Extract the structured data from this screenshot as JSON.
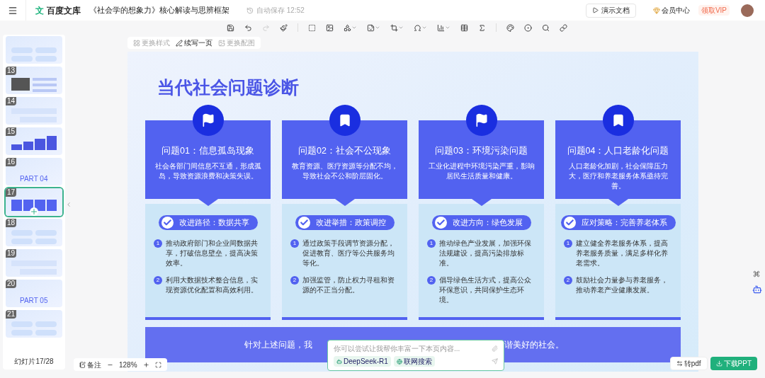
{
  "header": {
    "logo_mark": "文",
    "logo_text": "百度文库",
    "doc_title": "《社会学的想象力》核心解读与思辨框架",
    "autosave": "自动保存 12:52",
    "present_button": "演示文档",
    "member_center": "会员中心",
    "vip_badge": "领取VIP"
  },
  "toolbar": [
    {
      "kind": "save",
      "disabled": false,
      "dropdown": false
    },
    {
      "kind": "undo",
      "disabled": false,
      "dropdown": false
    },
    {
      "kind": "redo",
      "disabled": true,
      "dropdown": false
    },
    {
      "kind": "brush",
      "disabled": false,
      "dropdown": false
    },
    {
      "kind": "sep"
    },
    {
      "kind": "textbox",
      "disabled": false,
      "dropdown": false
    },
    {
      "kind": "image",
      "disabled": false,
      "dropdown": false
    },
    {
      "kind": "shapes",
      "disabled": false,
      "dropdown": true
    },
    {
      "kind": "sticker",
      "disabled": false,
      "dropdown": true
    },
    {
      "kind": "crop",
      "disabled": false,
      "dropdown": true
    },
    {
      "kind": "symbol",
      "disabled": false,
      "dropdown": true
    },
    {
      "kind": "chart",
      "disabled": false,
      "dropdown": true
    },
    {
      "kind": "table",
      "disabled": false,
      "dropdown": false
    },
    {
      "kind": "formula",
      "disabled": false,
      "dropdown": false
    },
    {
      "kind": "sep"
    },
    {
      "kind": "palette",
      "disabled": false,
      "dropdown": false
    },
    {
      "kind": "record",
      "disabled": false,
      "dropdown": false
    },
    {
      "kind": "search",
      "disabled": false,
      "dropdown": false
    },
    {
      "kind": "link",
      "disabled": false,
      "dropdown": false
    }
  ],
  "slide_actions": [
    {
      "label": "更换样式",
      "disabled": true
    },
    {
      "label": "续写一页",
      "disabled": false
    },
    {
      "label": "更换配图",
      "disabled": true
    }
  ],
  "thumbnails": [
    {
      "kind": "grid",
      "selected": false
    },
    {
      "number": "13",
      "kind": "photo",
      "selected": false
    },
    {
      "number": "14",
      "kind": "list",
      "selected": false
    },
    {
      "number": "15",
      "kind": "steps",
      "selected": false
    },
    {
      "number": "16",
      "kind": "section",
      "title": "PART 04",
      "selected": false
    },
    {
      "number": "17",
      "kind": "cards",
      "selected": true
    },
    {
      "number": "18",
      "kind": "grid",
      "selected": false
    },
    {
      "number": "19",
      "kind": "list",
      "selected": false
    },
    {
      "number": "20",
      "kind": "section",
      "title": "PART 05",
      "selected": false
    },
    {
      "number": "21",
      "kind": "grid",
      "selected": false
    }
  ],
  "slide_counter": "幻灯片17/28",
  "slide": {
    "title": "当代社会问题诊断",
    "cards": [
      {
        "title": "问题01：信息孤岛现象",
        "description": "社会各部门间信息不互通，形成孤岛，导致资源浪费和决策失误。",
        "badge": "改进路径：数据共享",
        "items": [
          {
            "number": "1",
            "text": "推动政府部门和企业间数据共享，打破信息壁垒，提高决策效率。"
          },
          {
            "number": "2",
            "text": "利用大数据技术整合信息，实现资源优化配置和高效利用。"
          }
        ]
      },
      {
        "title": "问题02：社会不公现象",
        "description": "教育资源、医疗资源等分配不均，导致社会不公和阶层固化。",
        "badge": "改进举措：政策调控",
        "items": [
          {
            "number": "1",
            "text": "通过政策手段调节资源分配，促进教育、医疗等公共服务均等化。"
          },
          {
            "number": "2",
            "text": "加强监管，防止权力寻租和资源的不正当分配。"
          }
        ]
      },
      {
        "title": "问题03：环境污染问题",
        "description": "工业化进程中环境污染严重，影响居民生活质量和健康。",
        "badge": "改进方向：绿色发展",
        "items": [
          {
            "number": "1",
            "text": "推动绿色产业发展，加强环保法规建设，提高污染排放标准。"
          },
          {
            "number": "2",
            "text": "倡导绿色生活方式，提高公众环保意识，共同保护生态环境。"
          }
        ]
      },
      {
        "title": "问题04：人口老龄化问题",
        "description": "人口老龄化加剧，社会保障压力大，医疗和养老服务体系亟待完善。",
        "badge": "应对策略：完善养老体系",
        "items": [
          {
            "number": "1",
            "text": "建立健全养老服务体系，提高养老服务质量，满足多样化养老需求。"
          },
          {
            "number": "2",
            "text": "鼓励社会力量参与养老服务，推动养老产业健康发展。"
          }
        ]
      }
    ],
    "banner_left": "针对上述问题，我",
    "banner_right": "谐美好的社会。"
  },
  "ai_popup": {
    "placeholder": "你可以尝试让我帮你丰富一下本页内容...",
    "chips": [
      "DeepSeek-R1",
      "联网搜索"
    ]
  },
  "zoom": {
    "notes": "备注",
    "level": "128%"
  },
  "export": {
    "pdf": "转pdf",
    "download": "下载PPT"
  }
}
